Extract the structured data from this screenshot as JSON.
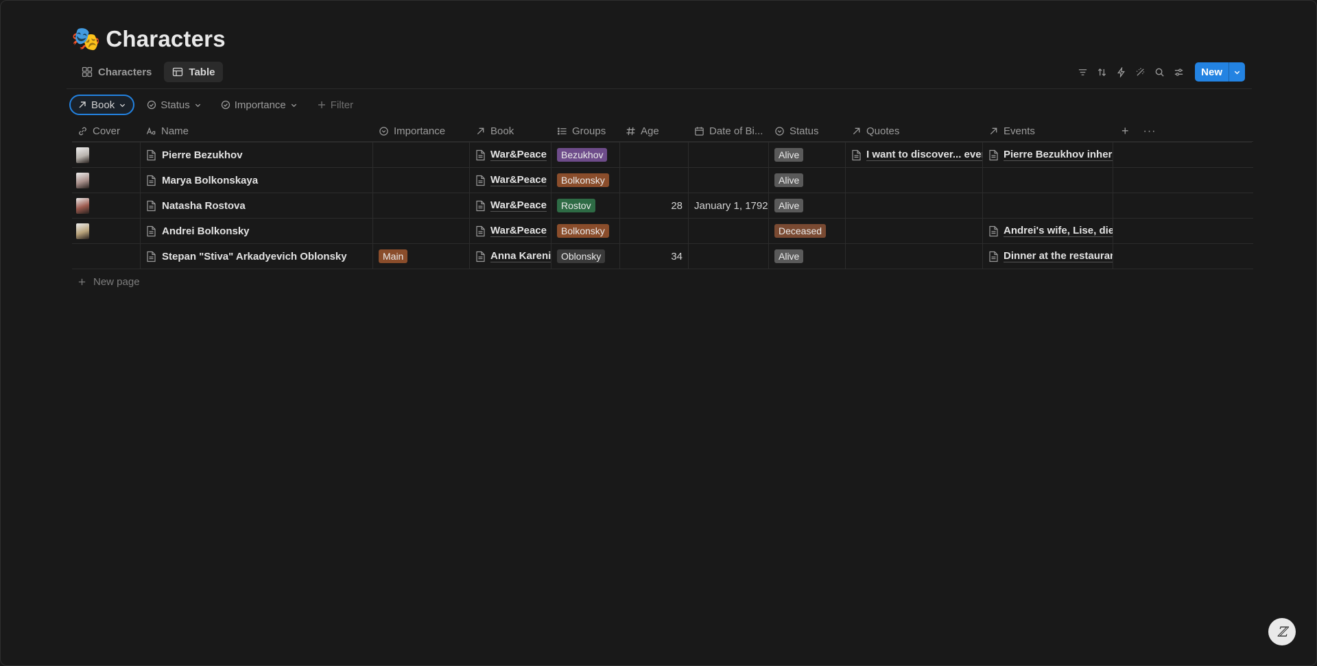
{
  "page": {
    "icon": "🎭",
    "title": "Characters"
  },
  "tabs": [
    {
      "label": "Characters",
      "icon": "gallery-icon"
    },
    {
      "label": "Table",
      "icon": "table-icon"
    }
  ],
  "toolbar": {
    "new_label": "New"
  },
  "filters": [
    {
      "label": "Book",
      "icon": "relation-arrow-icon"
    },
    {
      "label": "Status",
      "icon": "status-icon"
    },
    {
      "label": "Importance",
      "icon": "status-icon"
    },
    {
      "label": "Filter",
      "icon": "plus-icon"
    }
  ],
  "columns": {
    "cover": "Cover",
    "name": "Name",
    "importance": "Importance",
    "book": "Book",
    "groups": "Groups",
    "age": "Age",
    "dob": "Date of Bi...",
    "status": "Status",
    "quotes": "Quotes",
    "events": "Events"
  },
  "rows": [
    {
      "cover_color": "#b8b3ad",
      "name": "Pierre Bezukhov",
      "importance": "",
      "book": "War&Peace",
      "group": "Bezukhov",
      "group_color": "#6e4c8a",
      "age": "",
      "dob": "",
      "status": "Alive",
      "status_color": "#5a5a5a",
      "quote": "I want to discover... every",
      "event": "Pierre Bezukhov inherits"
    },
    {
      "cover_color": "#a88f8a",
      "name": "Marya Bolkonskaya",
      "importance": "",
      "book": "War&Peace",
      "group": "Bolkonsky",
      "group_color": "#8a4d2b",
      "age": "",
      "dob": "",
      "status": "Alive",
      "status_color": "#5a5a5a",
      "quote": "",
      "event": ""
    },
    {
      "cover_color": "#9c5a4e",
      "name": "Natasha Rostova",
      "importance": "",
      "book": "War&Peace",
      "group": "Rostov",
      "group_color": "#2e6b45",
      "age": "28",
      "dob": "January 1, 1792",
      "status": "Alive",
      "status_color": "#5a5a5a",
      "quote": "",
      "event": ""
    },
    {
      "cover_color": "#b8a27a",
      "name": "Andrei Bolkonsky",
      "importance": "",
      "book": "War&Peace",
      "group": "Bolkonsky",
      "group_color": "#8a4d2b",
      "age": "",
      "dob": "",
      "status": "Deceased",
      "status_color": "#7a4a32",
      "quote": "",
      "event": "Andrei's wife, Lise, dies"
    },
    {
      "cover_color": "",
      "name": "Stepan \"Stiva\" Arkadyevich Oblonsky",
      "importance": "Main",
      "importance_color": "#8a4d2b",
      "book": "Anna Karenina",
      "group": "Oblonsky",
      "group_color": "#3a3a3a",
      "age": "34",
      "dob": "",
      "status": "Alive",
      "status_color": "#5a5a5a",
      "quote": "",
      "event": "Dinner at the restaurant"
    }
  ],
  "new_page_label": "New page"
}
